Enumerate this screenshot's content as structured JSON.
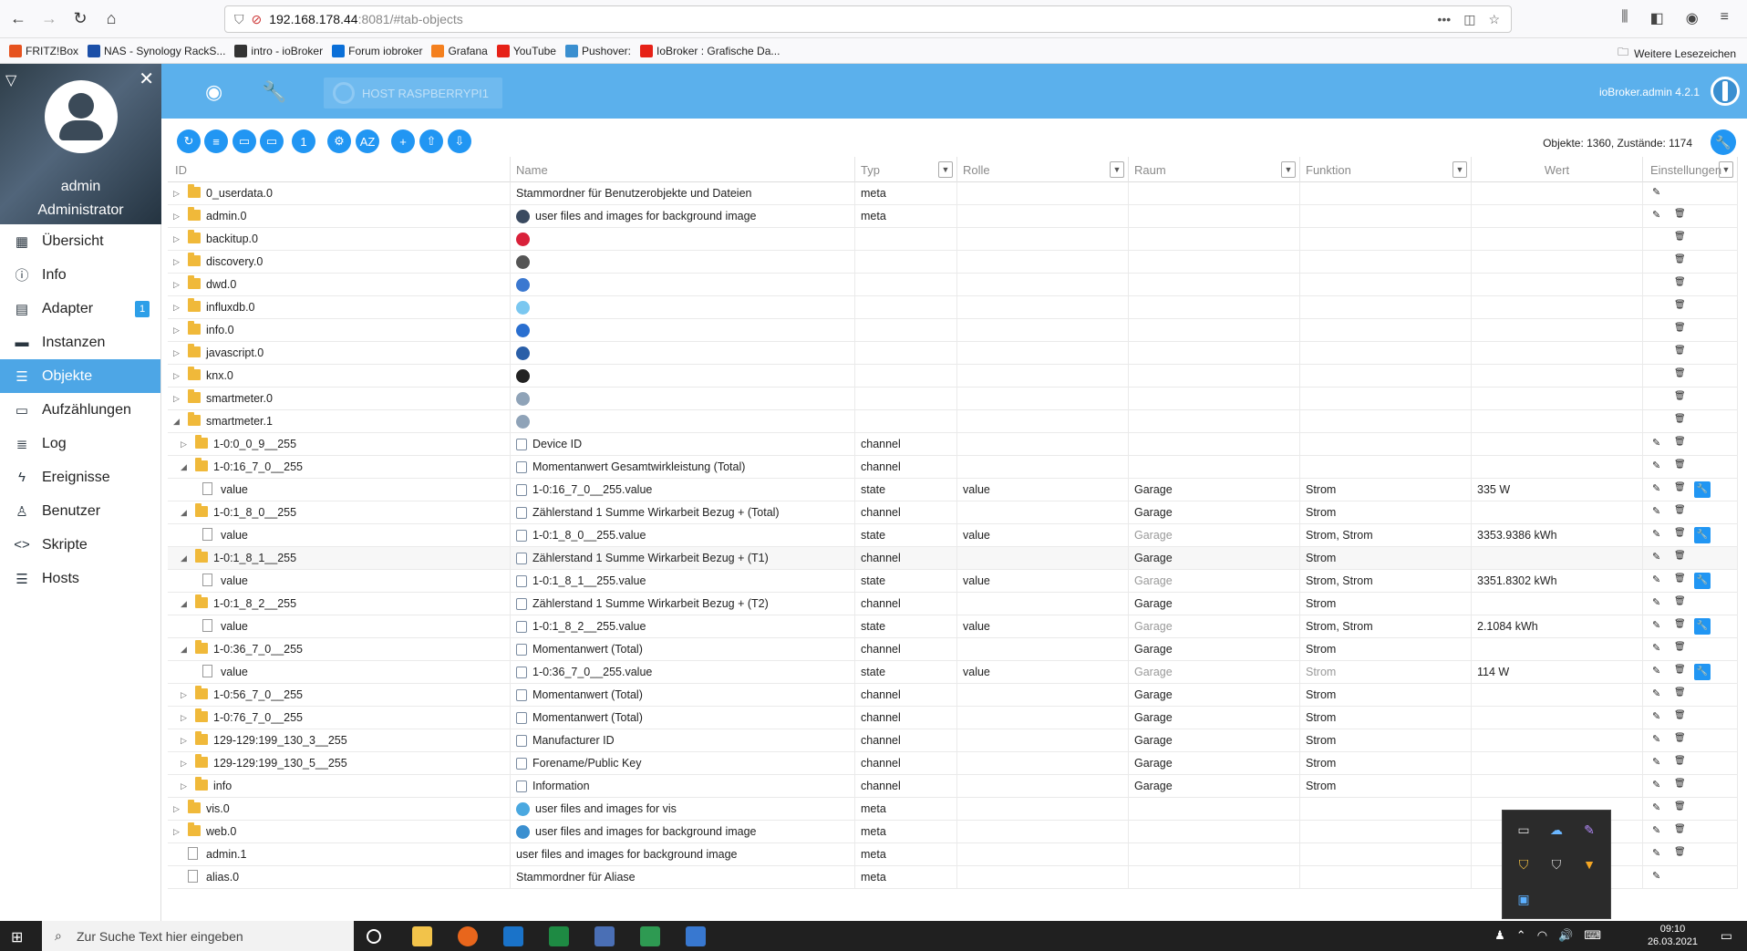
{
  "browser": {
    "url_host": "192.168.178.44",
    "url_path": ":8081/#tab-objects",
    "bookmarks": [
      "FRITZ!Box",
      "NAS - Synology RackS...",
      "intro - ioBroker",
      "Forum iobroker",
      "Grafana",
      "YouTube",
      "Pushover:",
      "IoBroker : Grafische Da..."
    ],
    "bookmarks_right": "Weitere Lesezeichen"
  },
  "profile": {
    "name": "admin",
    "role": "Administrator"
  },
  "menu": [
    {
      "label": "Übersicht",
      "icon": "grid-icon"
    },
    {
      "label": "Info",
      "icon": "info-icon"
    },
    {
      "label": "Adapter",
      "icon": "store-icon",
      "badge": "1"
    },
    {
      "label": "Instanzen",
      "icon": "instances-icon"
    },
    {
      "label": "Objekte",
      "icon": "list-icon",
      "active": true
    },
    {
      "label": "Aufzählungen",
      "icon": "enum-icon"
    },
    {
      "label": "Log",
      "icon": "log-icon"
    },
    {
      "label": "Ereignisse",
      "icon": "flash-icon"
    },
    {
      "label": "Benutzer",
      "icon": "user-icon"
    },
    {
      "label": "Skripte",
      "icon": "code-icon"
    },
    {
      "label": "Hosts",
      "icon": "hosts-icon"
    }
  ],
  "header": {
    "host": "HOST RASPBERRYPI1",
    "version": "ioBroker.admin 4.2.1"
  },
  "toolbar": {
    "counts": "Objekte: 1360, Zustände: 1174"
  },
  "columns": {
    "id": "ID",
    "name": "Name",
    "typ": "Typ",
    "rolle": "Rolle",
    "raum": "Raum",
    "funktion": "Funktion",
    "wert": "Wert",
    "settings": "Einstellungen"
  },
  "rows": [
    {
      "id": "0_userdata.0",
      "name": "Stammordner für Benutzerobjekte und Dateien",
      "typ": "meta",
      "rolle": "",
      "raum": "",
      "fkt": "",
      "wert": ""
    },
    {
      "id": "admin.0",
      "name": "user files and images for background image",
      "typ": "meta",
      "rolle": "",
      "raum": "",
      "fkt": "",
      "wert": ""
    },
    {
      "id": "backitup.0",
      "name": "",
      "typ": "",
      "rolle": "",
      "raum": "",
      "fkt": "",
      "wert": ""
    },
    {
      "id": "discovery.0",
      "name": "",
      "typ": "",
      "rolle": "",
      "raum": "",
      "fkt": "",
      "wert": ""
    },
    {
      "id": "dwd.0",
      "name": "",
      "typ": "",
      "rolle": "",
      "raum": "",
      "fkt": "",
      "wert": ""
    },
    {
      "id": "influxdb.0",
      "name": "",
      "typ": "",
      "rolle": "",
      "raum": "",
      "fkt": "",
      "wert": ""
    },
    {
      "id": "info.0",
      "name": "",
      "typ": "",
      "rolle": "",
      "raum": "",
      "fkt": "",
      "wert": ""
    },
    {
      "id": "javascript.0",
      "name": "",
      "typ": "",
      "rolle": "",
      "raum": "",
      "fkt": "",
      "wert": ""
    },
    {
      "id": "knx.0",
      "name": "",
      "typ": "",
      "rolle": "",
      "raum": "",
      "fkt": "",
      "wert": ""
    },
    {
      "id": "smartmeter.0",
      "name": "",
      "typ": "",
      "rolle": "",
      "raum": "",
      "fkt": "",
      "wert": ""
    },
    {
      "id": "smartmeter.1",
      "name": "",
      "typ": "",
      "rolle": "",
      "raum": "",
      "fkt": "",
      "wert": ""
    },
    {
      "id": "1-0:0_0_9__255",
      "name": "Device ID",
      "typ": "channel",
      "rolle": "",
      "raum": "",
      "fkt": "",
      "wert": ""
    },
    {
      "id": "1-0:16_7_0__255",
      "name": "Momentanwert Gesamtwirkleistung (Total)",
      "typ": "channel",
      "rolle": "",
      "raum": "",
      "fkt": "",
      "wert": ""
    },
    {
      "id": "value",
      "name": "1-0:16_7_0__255.value",
      "typ": "state",
      "rolle": "value",
      "raum": "Garage",
      "fkt": "Strom",
      "wert": "335 W"
    },
    {
      "id": "1-0:1_8_0__255",
      "name": "Zählerstand 1 Summe Wirkarbeit Bezug + (Total)",
      "typ": "channel",
      "rolle": "",
      "raum": "Garage",
      "fkt": "Strom",
      "wert": ""
    },
    {
      "id": "value",
      "name": "1-0:1_8_0__255.value",
      "typ": "state",
      "rolle": "value",
      "raum": "Garage",
      "fkt": "Strom, Strom",
      "wert": "3353.9386 kWh"
    },
    {
      "id": "1-0:1_8_1__255",
      "name": "Zählerstand 1 Summe Wirkarbeit Bezug + (T1)",
      "typ": "channel",
      "rolle": "",
      "raum": "Garage",
      "fkt": "Strom",
      "wert": ""
    },
    {
      "id": "value",
      "name": "1-0:1_8_1__255.value",
      "typ": "state",
      "rolle": "value",
      "raum": "Garage",
      "fkt": "Strom, Strom",
      "wert": "3351.8302 kWh"
    },
    {
      "id": "1-0:1_8_2__255",
      "name": "Zählerstand 1 Summe Wirkarbeit Bezug + (T2)",
      "typ": "channel",
      "rolle": "",
      "raum": "Garage",
      "fkt": "Strom",
      "wert": ""
    },
    {
      "id": "value",
      "name": "1-0:1_8_2__255.value",
      "typ": "state",
      "rolle": "value",
      "raum": "Garage",
      "fkt": "Strom, Strom",
      "wert": "2.1084 kWh"
    },
    {
      "id": "1-0:36_7_0__255",
      "name": "Momentanwert (Total)",
      "typ": "channel",
      "rolle": "",
      "raum": "Garage",
      "fkt": "Strom",
      "wert": ""
    },
    {
      "id": "value",
      "name": "1-0:36_7_0__255.value",
      "typ": "state",
      "rolle": "value",
      "raum": "Garage",
      "fkt": "Strom",
      "wert": "114 W"
    },
    {
      "id": "1-0:56_7_0__255",
      "name": "Momentanwert (Total)",
      "typ": "channel",
      "rolle": "",
      "raum": "Garage",
      "fkt": "Strom",
      "wert": ""
    },
    {
      "id": "1-0:76_7_0__255",
      "name": "Momentanwert (Total)",
      "typ": "channel",
      "rolle": "",
      "raum": "Garage",
      "fkt": "Strom",
      "wert": ""
    },
    {
      "id": "129-129:199_130_3__255",
      "name": "Manufacturer ID",
      "typ": "channel",
      "rolle": "",
      "raum": "Garage",
      "fkt": "Strom",
      "wert": ""
    },
    {
      "id": "129-129:199_130_5__255",
      "name": "Forename/Public Key",
      "typ": "channel",
      "rolle": "",
      "raum": "Garage",
      "fkt": "Strom",
      "wert": ""
    },
    {
      "id": "info",
      "name": "Information",
      "typ": "channel",
      "rolle": "",
      "raum": "Garage",
      "fkt": "Strom",
      "wert": ""
    },
    {
      "id": "vis.0",
      "name": "user files and images for vis",
      "typ": "meta",
      "rolle": "",
      "raum": "",
      "fkt": "",
      "wert": ""
    },
    {
      "id": "web.0",
      "name": "user files and images for background image",
      "typ": "meta",
      "rolle": "",
      "raum": "",
      "fkt": "",
      "wert": ""
    },
    {
      "id": "admin.1",
      "name": "user files and images for background image",
      "typ": "meta",
      "rolle": "",
      "raum": "",
      "fkt": "",
      "wert": ""
    },
    {
      "id": "alias.0",
      "name": "Stammordner für Aliase",
      "typ": "meta",
      "rolle": "",
      "raum": "",
      "fkt": "",
      "wert": ""
    }
  ],
  "taskbar": {
    "search_placeholder": "Zur Suche Text hier eingeben",
    "time": "09:10",
    "date": "26.03.2021"
  }
}
